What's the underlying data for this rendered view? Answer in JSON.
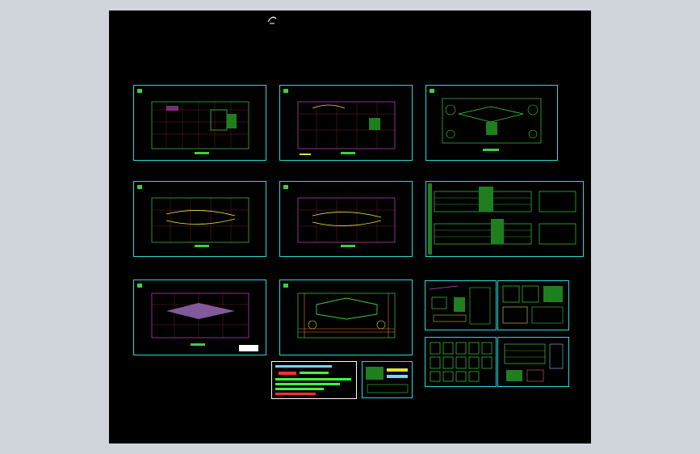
{
  "window": {
    "background": "#d0d4db",
    "canvas_background": "#000000"
  },
  "logo": {
    "text": "",
    "icon": "cad-logo-icon"
  },
  "sheets": [
    {
      "id": "plan-1",
      "kind": "floor-plan"
    },
    {
      "id": "plan-2",
      "kind": "floor-plan"
    },
    {
      "id": "plan-3",
      "kind": "site-plan"
    },
    {
      "id": "plan-4",
      "kind": "floor-plan"
    },
    {
      "id": "plan-5",
      "kind": "floor-plan"
    },
    {
      "id": "elev-1",
      "kind": "elevation"
    },
    {
      "id": "plan-6",
      "kind": "floor-plan"
    },
    {
      "id": "plan-7",
      "kind": "roof-plan"
    },
    {
      "id": "detail-1",
      "kind": "detail"
    },
    {
      "id": "detail-2",
      "kind": "detail"
    },
    {
      "id": "detail-3",
      "kind": "detail"
    },
    {
      "id": "detail-4",
      "kind": "detail"
    },
    {
      "id": "legend-1",
      "kind": "legend"
    }
  ],
  "stamp": {
    "line1": "",
    "line2": "",
    "line3": "",
    "line4": ""
  },
  "colors": {
    "sheet_border": "#27d9d9",
    "plan_lines": "#3ecf3e",
    "grid": "#c03030",
    "accent_magenta": "#cc44cc",
    "accent_yellow": "#e0e040"
  }
}
